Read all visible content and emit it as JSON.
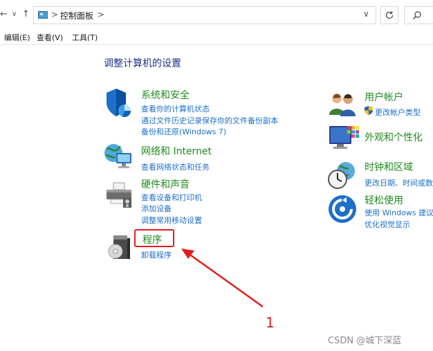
{
  "nav": {
    "back_glyph": "←",
    "forward_glyph": "→",
    "dropdown_glyph": "∨",
    "up_glyph": "↑",
    "separator_glyph": ">",
    "address_dropdown_glyph": "∨",
    "breadcrumb": "控制面板"
  },
  "menu": {
    "edit": "编辑(E)",
    "view": "查看(V)",
    "tools": "工具(T)"
  },
  "page_title": "调整计算机的设置",
  "left_categories": [
    {
      "title": "系统和安全",
      "icon": "shield-icon",
      "links": [
        "查看你的计算机状态",
        "通过文件历史记录保存你的文件备份副本",
        "备份和还原(Windows 7)"
      ]
    },
    {
      "title": "网络和 Internet",
      "icon": "network-globe-icon",
      "links": [
        "查看网络状态和任务"
      ]
    },
    {
      "title": "硬件和声音",
      "icon": "printer-icon",
      "links": [
        "查看设备和打印机",
        "添加设备",
        "调整常用移动设置"
      ]
    },
    {
      "title": "程序",
      "icon": "programs-disc-icon",
      "links": [
        "卸载程序"
      ]
    }
  ],
  "right_categories": [
    {
      "title": "用户帐户",
      "icon": "users-icon",
      "links": [
        "更改帐户类型"
      ]
    },
    {
      "title": "外观和个性化",
      "icon": "appearance-monitor-icon",
      "links": []
    },
    {
      "title": "时钟和区域",
      "icon": "clock-globe-icon",
      "links": [
        "更改日期、时间或数"
      ]
    },
    {
      "title": "轻松使用",
      "icon": "ease-of-access-icon",
      "links": [
        "使用 Windows 建议",
        "优化视觉显示"
      ]
    }
  ],
  "annotation": {
    "step_number": "1",
    "color": "#e11d1d"
  },
  "watermark": "CSDN @城下深蓝",
  "colors": {
    "category_title": "#1e8a1e",
    "link": "#1e6fc8",
    "page_title": "#1e3287"
  }
}
